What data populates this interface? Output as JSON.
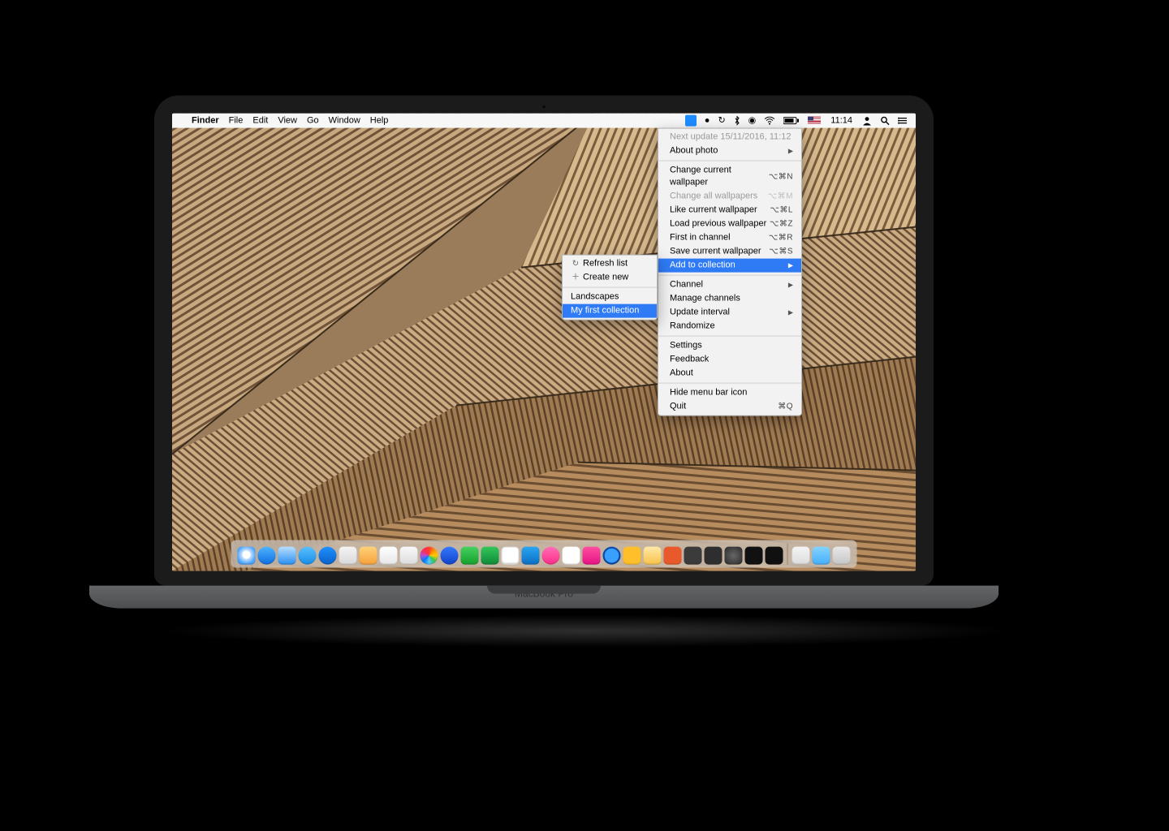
{
  "device_label": "MacBook Pro",
  "menubar": {
    "app": "Finder",
    "items": [
      "File",
      "Edit",
      "View",
      "Go",
      "Window",
      "Help"
    ],
    "clock": "11:14"
  },
  "dropdown": {
    "next_update": "Next update 15/11/2016, 11:12",
    "about_photo": "About photo",
    "change_current": "Change current wallpaper",
    "change_current_sc": "⌥⌘N",
    "change_all": "Change all wallpapers",
    "change_all_sc": "⌥⌘M",
    "like_current": "Like current wallpaper",
    "like_current_sc": "⌥⌘L",
    "load_previous": "Load previous wallpaper",
    "load_previous_sc": "⌥⌘Z",
    "first_in_channel": "First in channel",
    "first_in_channel_sc": "⌥⌘R",
    "save_current": "Save current wallpaper",
    "save_current_sc": "⌥⌘S",
    "add_to_collection": "Add to collection",
    "channel": "Channel",
    "manage_channels": "Manage channels",
    "update_interval": "Update interval",
    "randomize": "Randomize",
    "settings": "Settings",
    "feedback": "Feedback",
    "about": "About",
    "hide_icon": "Hide menu bar icon",
    "quit": "Quit",
    "quit_sc": "⌘Q"
  },
  "submenu": {
    "refresh": "Refresh list",
    "create": "Create new",
    "coll1": "Landscapes",
    "coll2": "My first collection"
  }
}
